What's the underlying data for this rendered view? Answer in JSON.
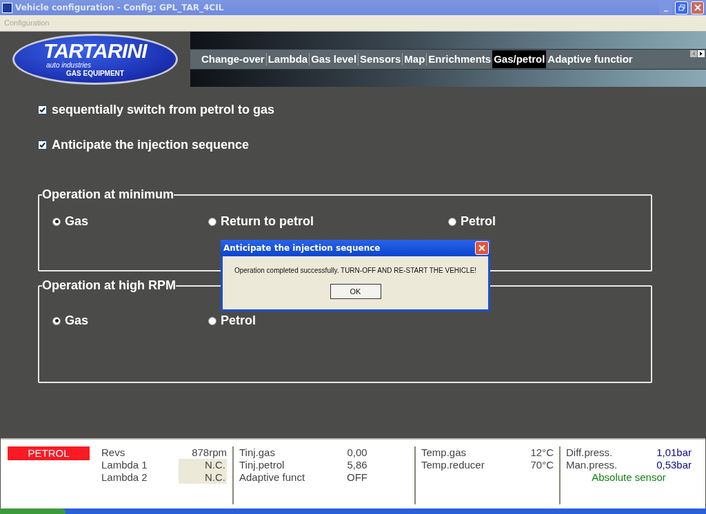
{
  "window": {
    "title": "Vehicle configuration - Config: GPL_TAR_4CIL"
  },
  "menu": [
    "Configuration"
  ],
  "logo": {
    "name": "TARTARINI",
    "subtitle": "auto industries",
    "tagline": "GAS EQUIPMENT"
  },
  "tabs": [
    {
      "label": "Change-over",
      "selected": false
    },
    {
      "label": "Lambda",
      "selected": false
    },
    {
      "label": "Gas level",
      "selected": false
    },
    {
      "label": "Sensors",
      "selected": false
    },
    {
      "label": "Map",
      "selected": false
    },
    {
      "label": "Enrichments",
      "selected": false
    },
    {
      "label": "Gas/petrol",
      "selected": true
    },
    {
      "label": "Adaptive functior",
      "selected": false
    }
  ],
  "options": [
    {
      "label": "sequentially switch from petrol to gas",
      "checked": true
    },
    {
      "label": "Anticipate the injection sequence",
      "checked": true
    }
  ],
  "groups": [
    {
      "title": "Operation at minimum",
      "choices": [
        {
          "label": "Gas",
          "selected": true
        },
        {
          "label": "Return to petrol",
          "selected": false
        },
        {
          "label": "Petrol",
          "selected": false
        }
      ]
    },
    {
      "title": "Operation at high RPM",
      "choices": [
        {
          "label": "Gas",
          "selected": true
        },
        {
          "label": "Petrol",
          "selected": false
        }
      ]
    }
  ],
  "dialog": {
    "title": "Anticipate the injection sequence",
    "message": "Operation completed successfully. TURN-OFF AND RE-START THE VEHICLE!",
    "button": "OK"
  },
  "status": {
    "mode": "PETROL",
    "columns": [
      [
        {
          "label": "Revs",
          "value": "878rpm",
          "kind": "plain"
        },
        {
          "label": "Lambda 1",
          "value": "N.C.",
          "kind": "shaded"
        },
        {
          "label": "Lambda 2",
          "value": "N.C.",
          "kind": "shaded"
        }
      ],
      [
        {
          "label": "Tinj.gas",
          "value": "0,00",
          "kind": "center"
        },
        {
          "label": "Tinj.petrol",
          "value": "5,86",
          "kind": "center"
        },
        {
          "label": "Adaptive funct",
          "value": "OFF",
          "kind": "center"
        }
      ],
      [
        {
          "label": "Temp.gas",
          "value": "12°C",
          "kind": "plain"
        },
        {
          "label": "Temp.reducer",
          "value": "70°C",
          "kind": "plain"
        }
      ],
      [
        {
          "label": "Diff.press.",
          "value": "1,01bar",
          "kind": "blue"
        },
        {
          "label": "Man.press.",
          "value": "0,53bar",
          "kind": "blue"
        }
      ]
    ],
    "note": "Absolute sensor"
  }
}
